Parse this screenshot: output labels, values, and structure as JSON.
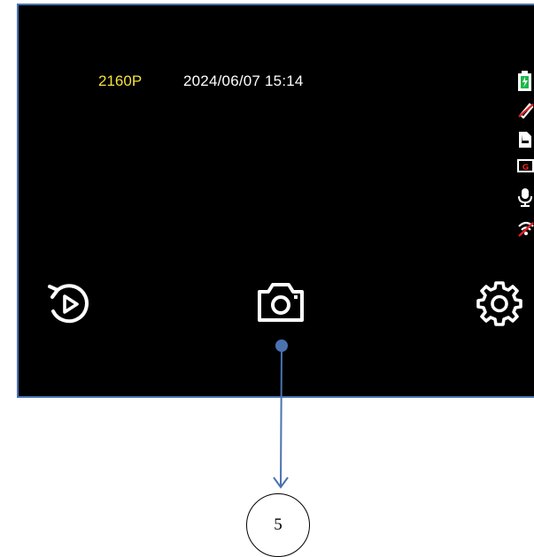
{
  "status_bar": {
    "resolution": "2160P",
    "datetime": "2024/06/07  15:14"
  },
  "status_icons": [
    "battery-charging-icon",
    "gps-off-icon",
    "file-icon",
    "g-sensor-icon",
    "microphone-icon",
    "wifi-off-icon"
  ],
  "controls": {
    "left": "playback-icon",
    "center": "camera-icon",
    "right": "settings-gear-icon"
  },
  "callout": {
    "number": "5"
  },
  "colors": {
    "screen_bg": "#000000",
    "screen_border": "#4a72b0",
    "resolution_text": "#f4e23a",
    "callout_line": "#4a72b0",
    "off_indicator": "#e02020"
  }
}
